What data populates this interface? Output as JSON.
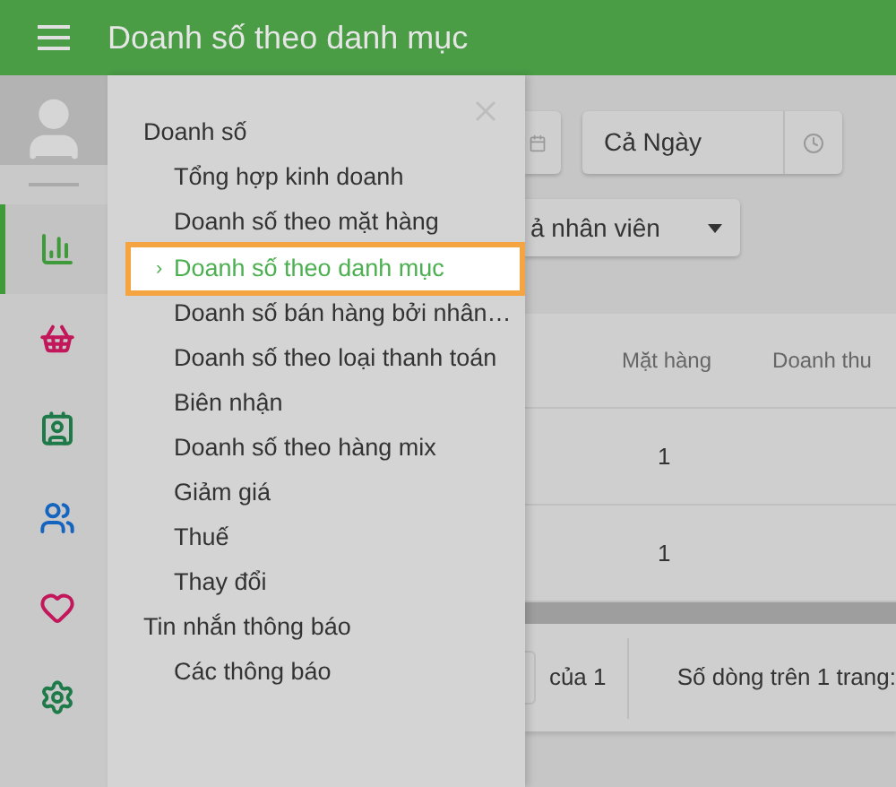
{
  "header": {
    "title": "Doanh số theo danh mục"
  },
  "rail": {
    "items": [
      {
        "kind": "chart",
        "selected": true
      },
      {
        "kind": "basket",
        "selected": false
      },
      {
        "kind": "card",
        "selected": false
      },
      {
        "kind": "people",
        "selected": false
      },
      {
        "kind": "heart",
        "selected": false
      },
      {
        "kind": "gear",
        "selected": false
      }
    ]
  },
  "menu": {
    "groups": [
      {
        "label": "Doanh số",
        "children": [
          {
            "label": "Tổng hợp kinh doanh",
            "selected": false
          },
          {
            "label": "Doanh số theo mặt hàng",
            "selected": false
          },
          {
            "label": "Doanh số theo danh mục",
            "selected": true
          },
          {
            "label": "Doanh số bán hàng bởi nhân…",
            "selected": false
          },
          {
            "label": "Doanh số theo loại thanh toán",
            "selected": false
          },
          {
            "label": "Biên nhận",
            "selected": false
          },
          {
            "label": "Doanh số theo hàng mix",
            "selected": false
          },
          {
            "label": "Giảm giá",
            "selected": false
          },
          {
            "label": "Thuế",
            "selected": false
          },
          {
            "label": "Thay đổi",
            "selected": false
          }
        ]
      },
      {
        "label": "Tin nhắn thông báo",
        "children": [
          {
            "label": "Các thông báo",
            "selected": false
          }
        ]
      }
    ],
    "selected_marker": "›"
  },
  "filters": {
    "time": "Cả Ngày",
    "employee": "ả nhân viên"
  },
  "table": {
    "columns": [
      "Mặt hàng",
      "Doanh thu"
    ],
    "rows": [
      [
        "1"
      ],
      [
        "1"
      ]
    ]
  },
  "pagination": {
    "page_count": "của 1",
    "rows_per_page": "Số dòng trên 1 trang:"
  }
}
